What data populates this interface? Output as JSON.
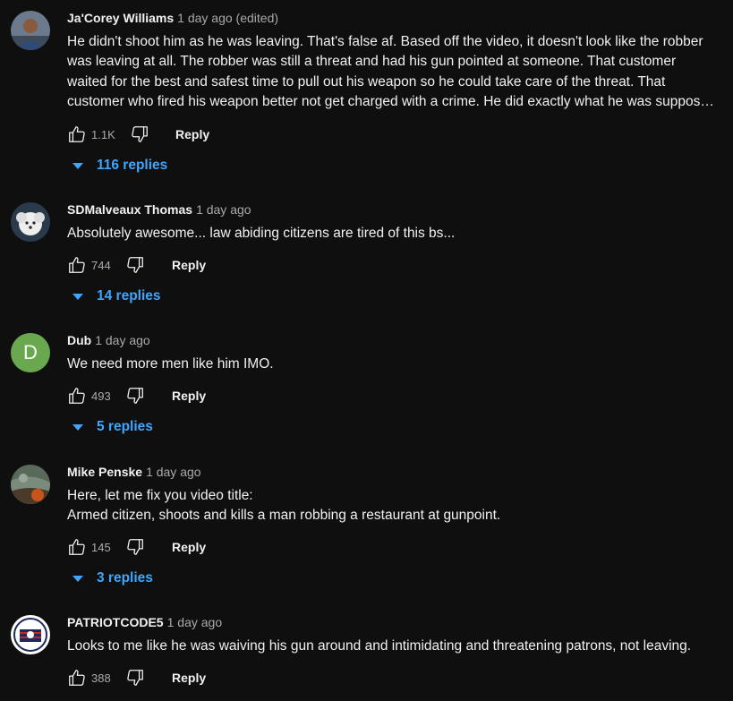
{
  "comments": [
    {
      "author": "Ja'Corey Williams",
      "time": "1 day ago (edited)",
      "lines": [
        "He didn't shoot him as he was leaving. That's false af. Based off the video, it doesn't look like the robber",
        "was leaving at all. The robber was still a threat and had his gun pointed at someone. That customer",
        "waited for the best and safest time to pull out his weapon so he could take care of the threat. That",
        "customer who fired his weapon better not get charged with a crime. He did exactly what he was supposed to do."
      ],
      "likes": "1.1K",
      "reply_label": "Reply",
      "replies": "116 replies",
      "avatar_icon": "person-photo-avatar"
    },
    {
      "author": "SDMalveaux Thomas",
      "time": "1 day ago",
      "lines": [
        "Absolutely awesome... law abiding citizens are tired of this bs..."
      ],
      "likes": "744",
      "reply_label": "Reply",
      "replies": "14 replies",
      "avatar_icon": "dog-photo-avatar"
    },
    {
      "author": "Dub",
      "time": "1 day ago",
      "lines": [
        "We need more men like him IMO."
      ],
      "likes": "493",
      "reply_label": "Reply",
      "replies": "5 replies",
      "avatar_letter": "D",
      "avatar_color": "#6aa84f"
    },
    {
      "author": "Mike Penske",
      "time": "1 day ago",
      "lines": [
        "Here, let me fix you video title:",
        "Armed citizen, shoots and kills a man robbing a restaurant at gunpoint."
      ],
      "likes": "145",
      "reply_label": "Reply",
      "replies": "3 replies",
      "avatar_icon": "landscape-photo-avatar"
    },
    {
      "author": "PATRIOTCODE5",
      "time": "1 day ago",
      "lines": [
        "Looks to me like he was waiving his gun around and intimidating and threatening patrons, not leaving."
      ],
      "likes": "388",
      "reply_label": "Reply",
      "avatar_icon": "patriot-logo-avatar"
    }
  ],
  "colors": {
    "background": "#0f0f0f",
    "text": "#f1f1f1",
    "secondary_text": "#aaaaaa",
    "link_blue": "#3ea6ff"
  }
}
